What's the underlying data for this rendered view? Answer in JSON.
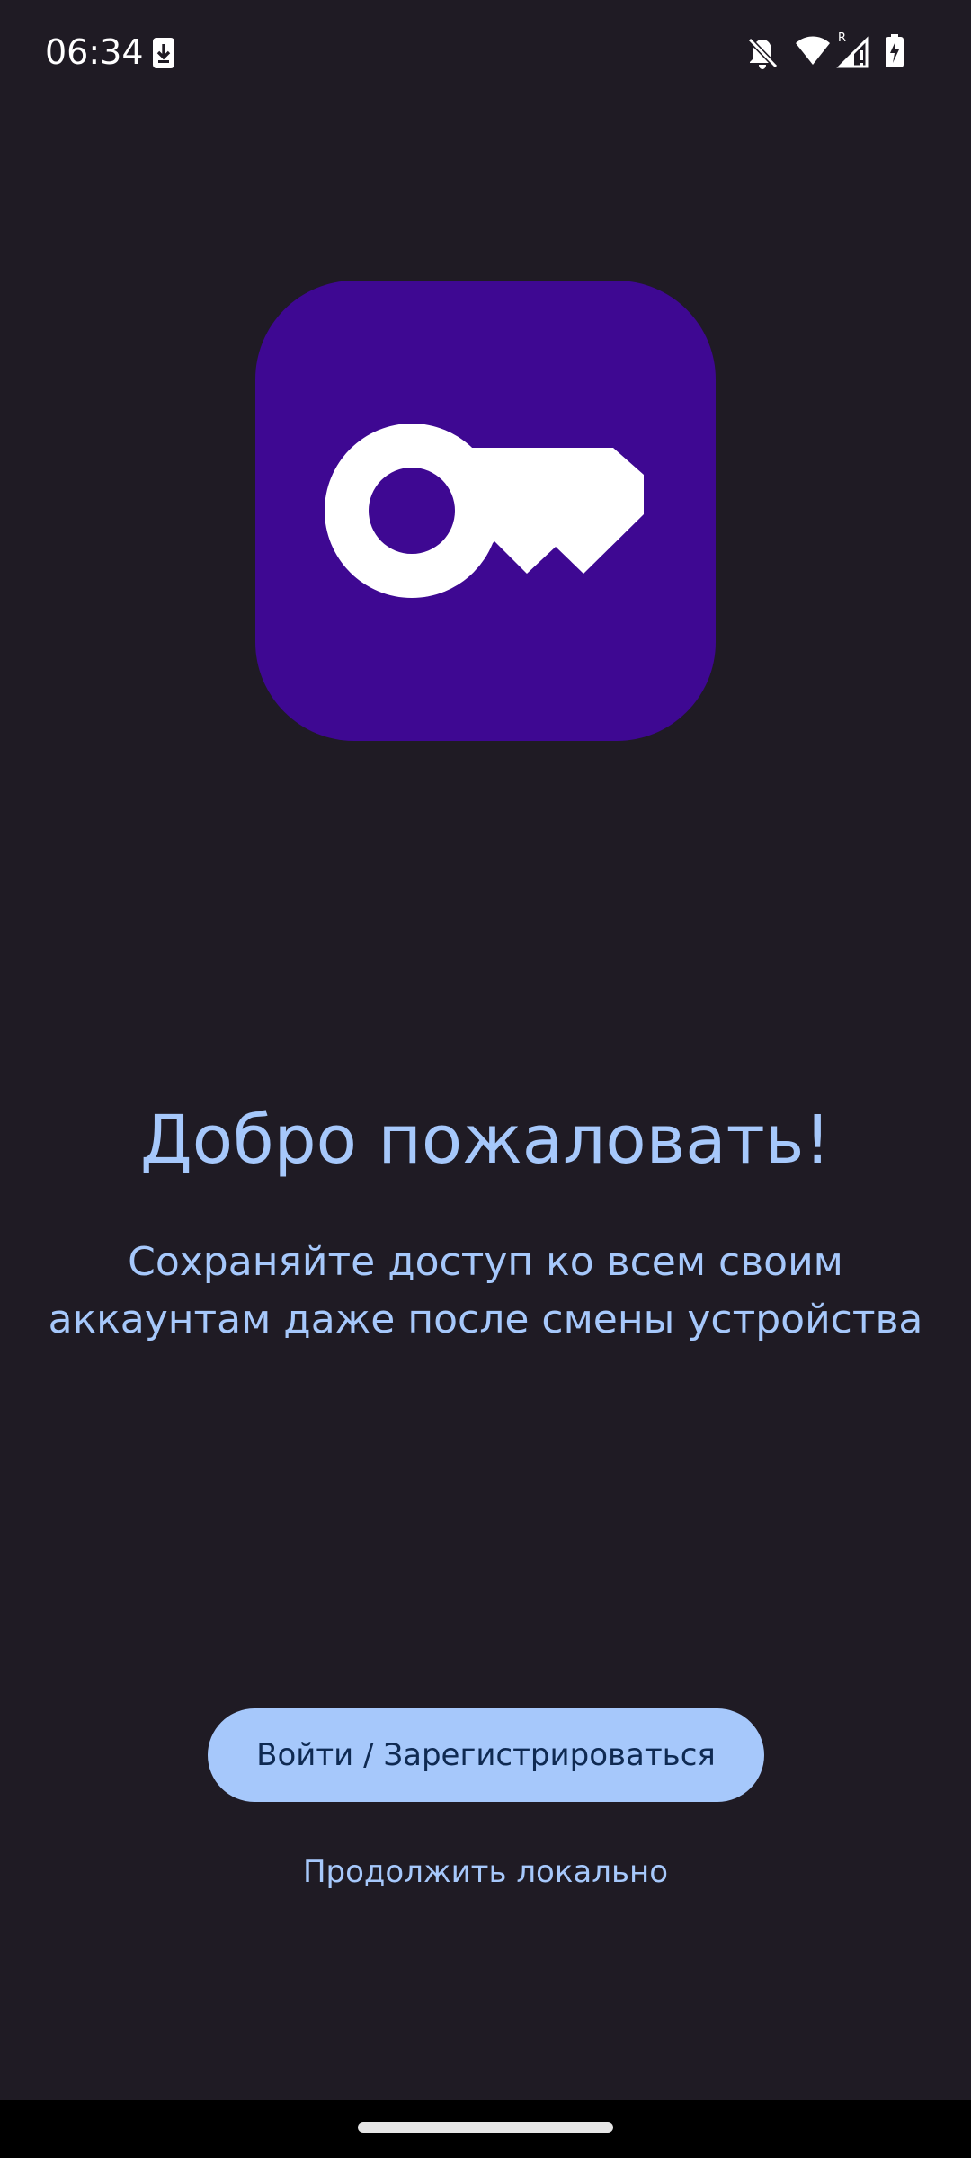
{
  "status_bar": {
    "time": "06:34",
    "icons": [
      "download-icon",
      "notifications-off-icon",
      "wifi-icon",
      "signal-roaming-icon",
      "battery-charging-icon"
    ],
    "roaming_label": "R"
  },
  "logo": {
    "icon": "key-icon",
    "background_color": "#3e0892",
    "icon_color": "#ffffff"
  },
  "welcome": {
    "title": "Добро пожаловать!",
    "subtitle": "Сохраняйте доступ ко всем своим аккаунтам даже после смены устройства"
  },
  "actions": {
    "login_label": "Войти / Зарегистрироваться",
    "continue_local_label": "Продолжить локально"
  },
  "colors": {
    "background": "#1f1b24",
    "accent": "#a6c8fb",
    "button_text": "#0f2a52"
  }
}
